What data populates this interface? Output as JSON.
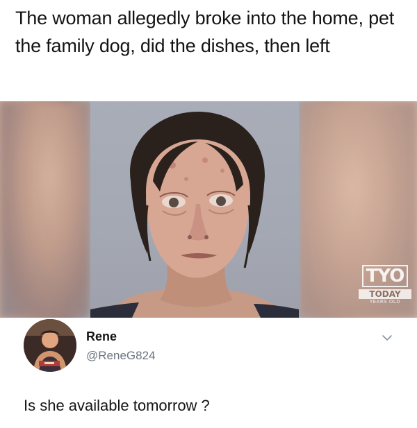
{
  "headline": "The woman allegedly broke into the home, pet the family dog, did the dishes, then left",
  "watermark": {
    "logo": "TYO",
    "subtitle": "TODAY",
    "small": "YEARS OLD"
  },
  "tweet": {
    "author_name": "Rene",
    "author_handle": "@ReneG824",
    "text": "Is she available tomorrow ?",
    "menu_icon": "chevron-down-icon"
  }
}
